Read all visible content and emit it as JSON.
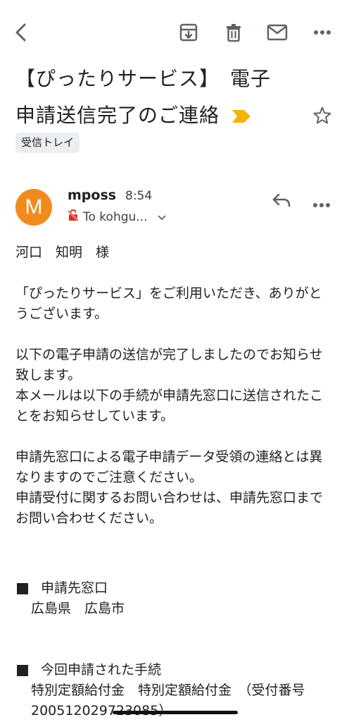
{
  "toolbar": {
    "back": "back-arrow-icon",
    "archive": "archive-icon",
    "delete": "trash-icon",
    "mark_unread": "mail-icon",
    "more": "more-horizontal-icon"
  },
  "email": {
    "subject": "【ぴったりサービス】　電子申請送信完了のご連絡",
    "label": "受信トレイ",
    "sender": {
      "initial": "M",
      "name": "mposs",
      "time": "8:54",
      "to": "To kohgu...",
      "avatar_color": "#f28b1e"
    },
    "body": {
      "greeting": "河口　知明　様",
      "para1": "「ぴったりサービス」をご利用いただき、ありがとうございます。",
      "para2a": "以下の電子申請の送信が完了しましたのでお知らせ致します。",
      "para2b": "本メールは以下の手続が申請先窓口に送信されたことをお知らせしています。",
      "para3a": "申請先窓口による電子申請データ受領の連絡とは異なりますのでご注意ください。",
      "para3b": "申請受付に関するお問い合わせは、申請先窓口までお問い合わせください。",
      "section1_title": "申請先窓口",
      "section1_value": "広島県　広島市",
      "section2_title": "今回申請された手続",
      "section2_value": "特別定額給付金　特別定額給付金　（受付番号200512029723085）"
    }
  },
  "colors": {
    "important_marker": "#f4b400",
    "accent_avatar": "#f28b1e"
  }
}
